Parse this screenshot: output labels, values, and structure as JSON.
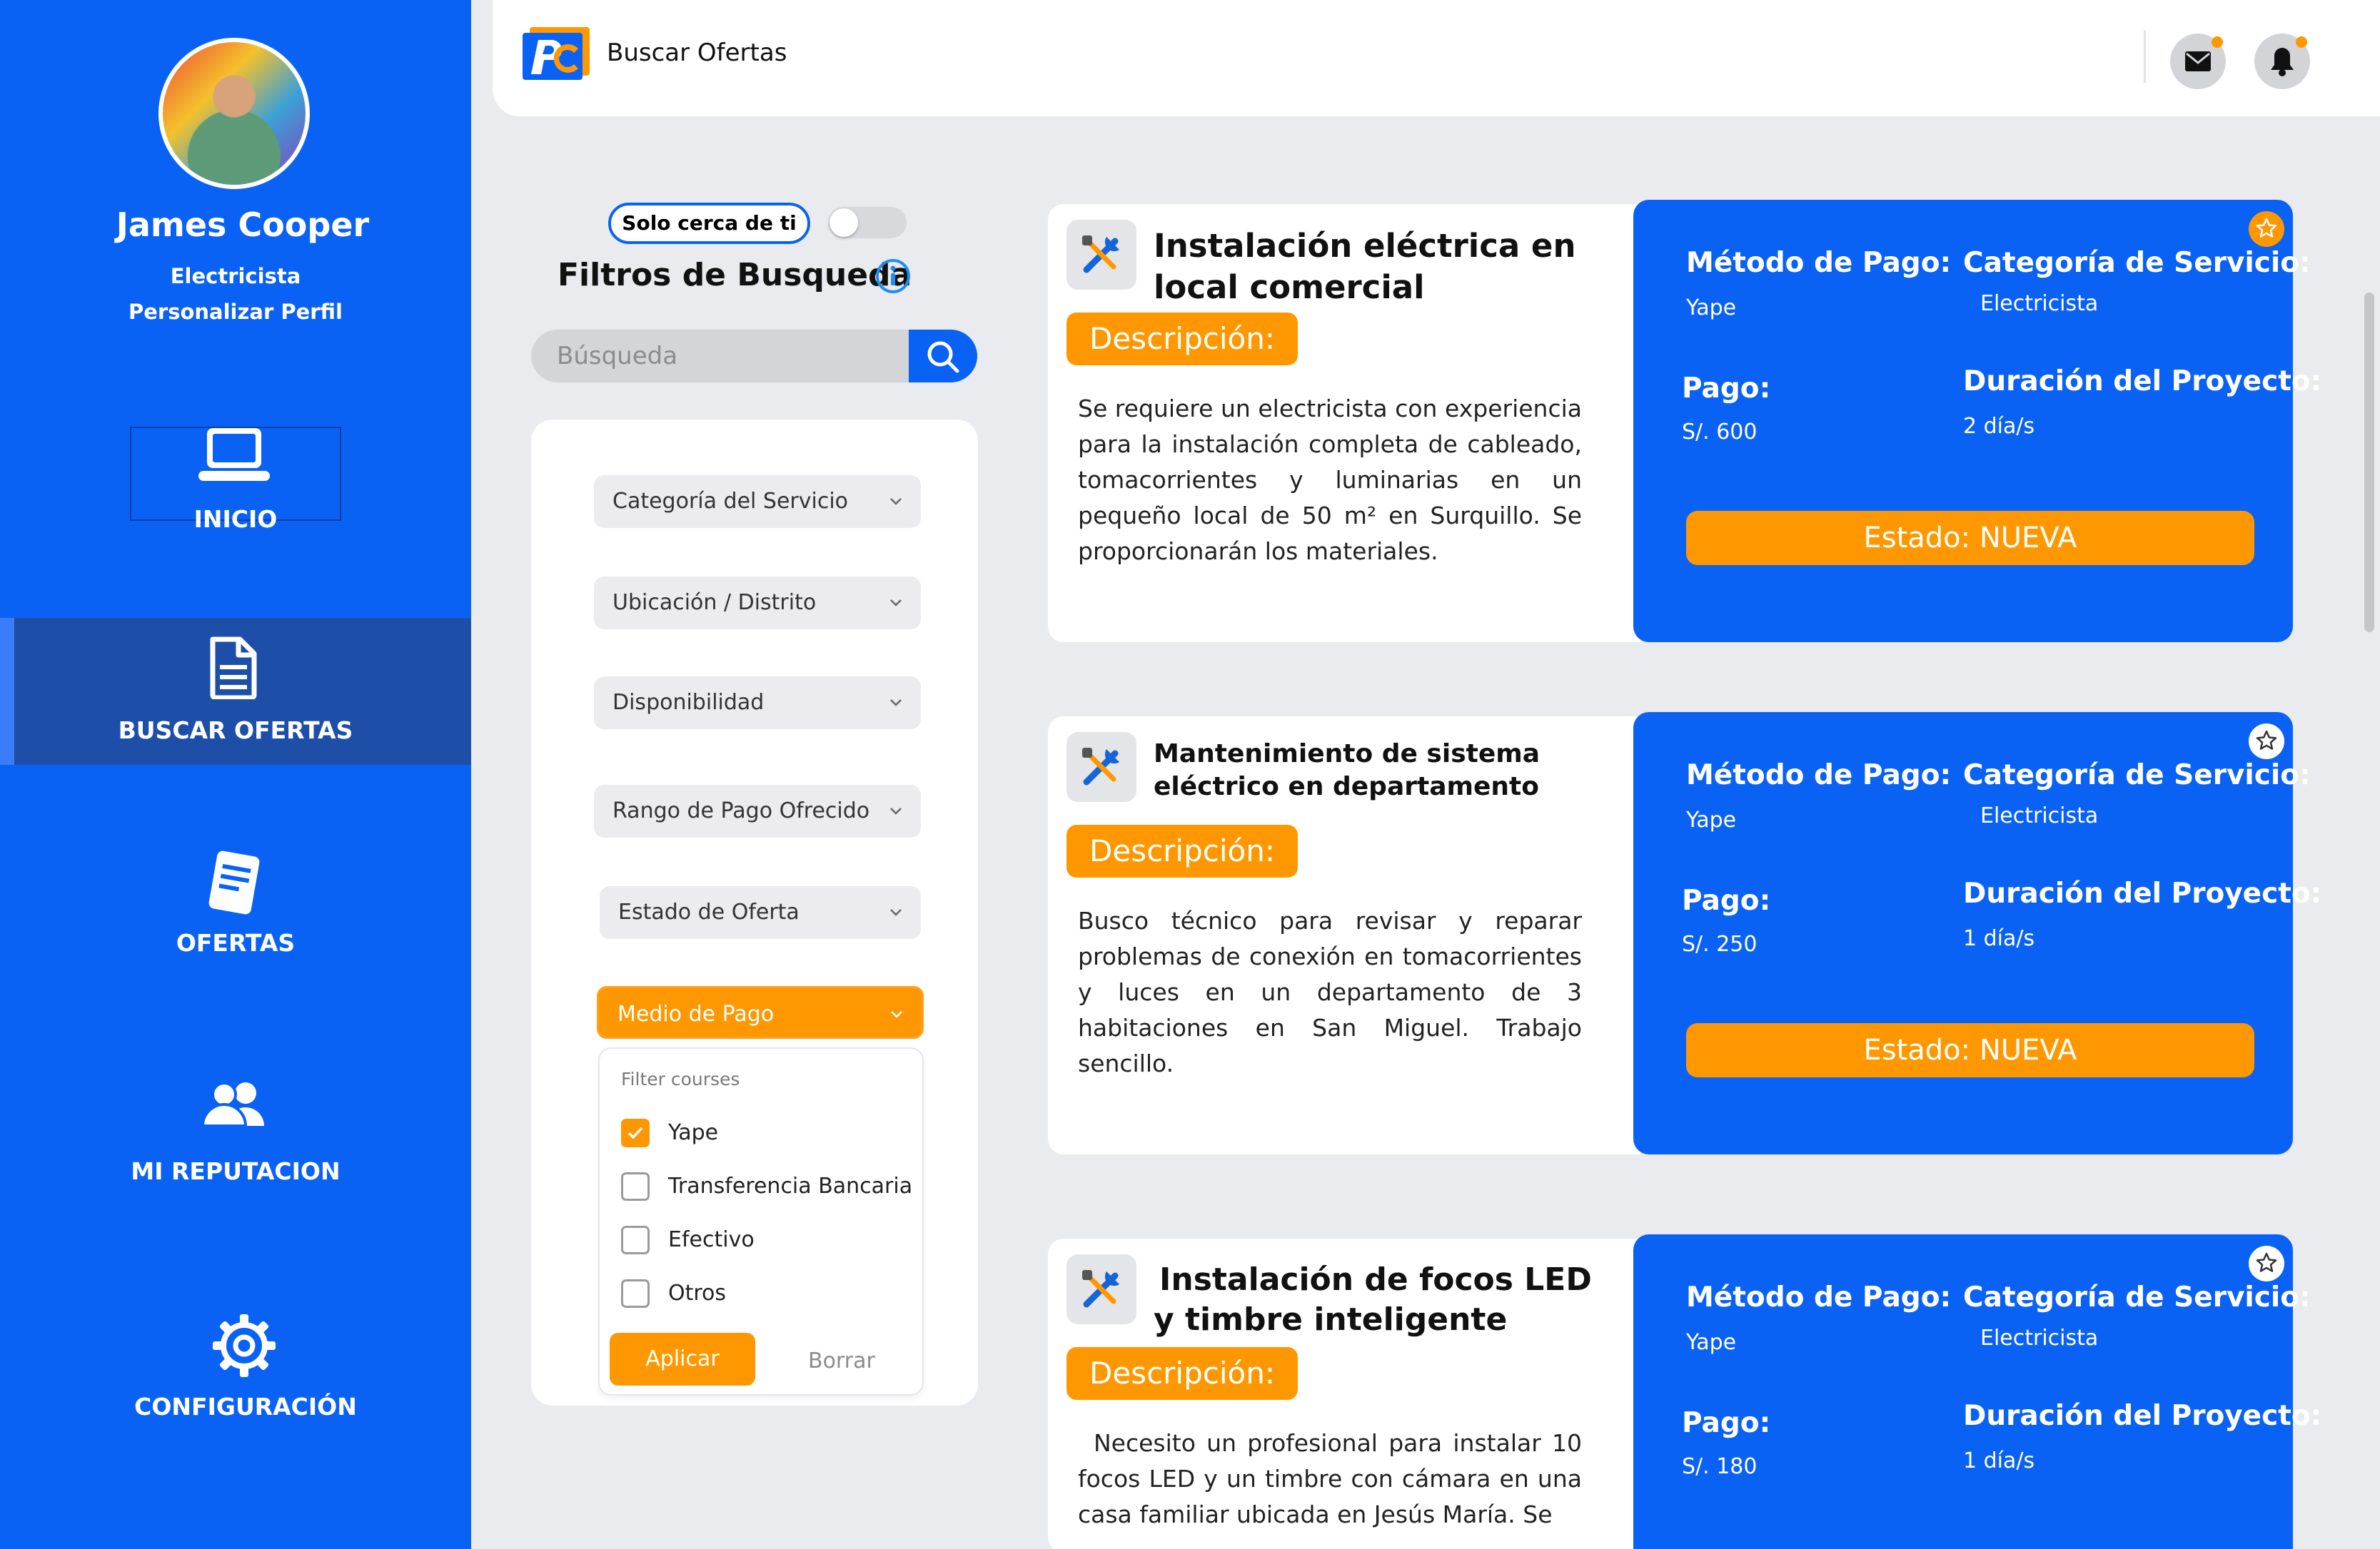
{
  "sidebar": {
    "user_name": "James Cooper",
    "user_role": "Electricista",
    "edit_profile": "Personalizar Perfil",
    "nav": [
      {
        "label": "INICIO",
        "icon": "laptop-icon",
        "active": false
      },
      {
        "label": "BUSCAR OFERTAS",
        "icon": "document-icon",
        "active": true
      },
      {
        "label": "OFERTAS",
        "icon": "notepad-icon",
        "active": false
      },
      {
        "label": "MI REPUTACION",
        "icon": "users-icon",
        "active": false
      },
      {
        "label": "CONFIGURACIÓN",
        "icon": "gear-icon",
        "active": false
      }
    ]
  },
  "header": {
    "title": "Buscar Ofertas",
    "icons": [
      "mail-icon",
      "bell-icon"
    ]
  },
  "filters": {
    "near_label": "Solo cerca de ti",
    "near_enabled": false,
    "title": "Filtros de Busqueda",
    "search_placeholder": "Búsqueda",
    "dropdowns": [
      "Categoría del Servicio",
      "Ubicación / Distrito",
      "Disponibilidad",
      "Rango de Pago Ofrecido",
      "Estado de Oferta",
      "Medio de Pago"
    ],
    "payment_menu": {
      "header": "Filter courses",
      "options": [
        {
          "label": "Yape",
          "checked": true
        },
        {
          "label": "Transferencia Bancaria",
          "checked": false
        },
        {
          "label": "Efectivo",
          "checked": false
        },
        {
          "label": "Otros",
          "checked": false
        }
      ],
      "apply": "Aplicar",
      "clear": "Borrar"
    }
  },
  "card_labels": {
    "description": "Descripción:",
    "payment_method": "Método de Pago:",
    "category": "Categoría de Servicio:",
    "payment": "Pago:",
    "duration": "Duración del Proyecto:"
  },
  "offers": [
    {
      "title_line1": "Instalación eléctrica en",
      "title_line2": "local comercial",
      "description": "Se requiere un electricista con experiencia para la instalación completa de cableado, tomacorrientes y luminarias en un pequeño local de 50 m² en Surquillo. Se proporcionarán los materiales.",
      "payment_method": "Yape",
      "category": "Electricista",
      "payment": "S/. 600",
      "duration": "2 día/s",
      "status": "Estado: NUEVA",
      "favorite": true
    },
    {
      "title_line1": "Mantenimiento de sistema",
      "title_line2": "eléctrico en departamento",
      "description": "Busco técnico para revisar y reparar problemas de conexión en tomacorrientes y luces en un departamento de 3 habitaciones en San Miguel. Trabajo sencillo.",
      "payment_method": "Yape",
      "category": "Electricista",
      "payment": "S/. 250",
      "duration": "1 día/s",
      "status": "Estado: NUEVA",
      "favorite": false
    },
    {
      "title_line1": "Instalación de focos LED",
      "title_line2": "y timbre inteligente",
      "description": "Necesito un profesional para instalar 10 focos LED y un timbre con cámara en una casa familiar ubicada en Jesús María. Se",
      "payment_method": "Yape",
      "category": "Electricista",
      "payment": "S/. 180",
      "duration": "1 día/s",
      "status": "Estado: NUEVA",
      "favorite": false
    }
  ],
  "colors": {
    "primary": "#0a62f5",
    "accent": "#ff9800",
    "sidebar_active": "#1e4fa8",
    "background": "#e9ebee"
  }
}
